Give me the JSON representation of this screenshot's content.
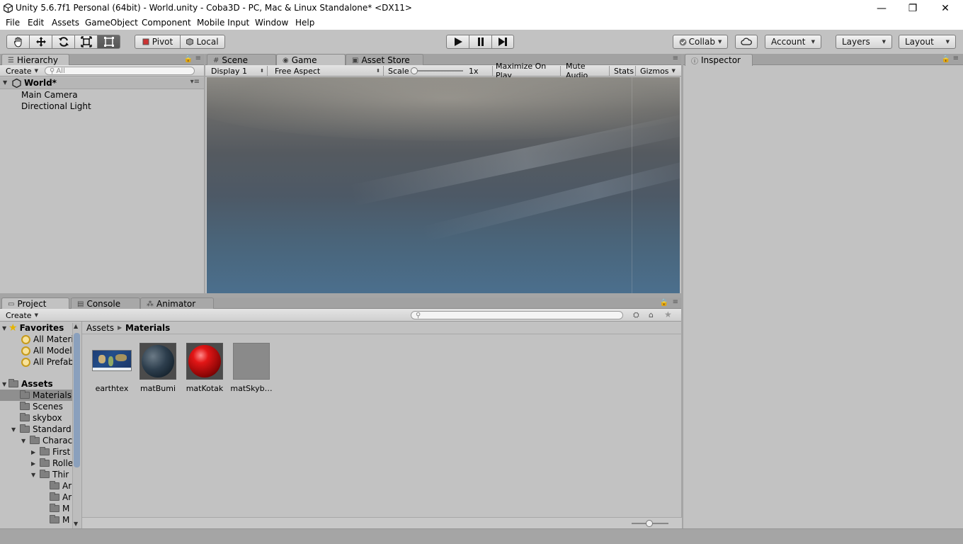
{
  "window": {
    "title": "Unity 5.6.7f1 Personal (64bit) - World.unity - Coba3D - PC, Mac & Linux Standalone* <DX11>",
    "controls": {
      "minimize": "—",
      "restore": "❐",
      "close": "✕"
    }
  },
  "menu": [
    "File",
    "Edit",
    "Assets",
    "GameObject",
    "Component",
    "Mobile Input",
    "Window",
    "Help"
  ],
  "toolbar": {
    "tools": [
      "hand-icon",
      "move-icon",
      "rotate-icon",
      "scale-icon",
      "rect-icon"
    ],
    "pivot": "Pivot",
    "local": "Local",
    "collab": "Collab",
    "account": "Account",
    "layers": "Layers",
    "layout": "Layout"
  },
  "hierarchy": {
    "tab": "Hierarchy",
    "create": "Create",
    "search_placeholder": "All",
    "scene": "World*",
    "items": [
      "Main Camera",
      "Directional Light"
    ]
  },
  "center_tabs": [
    "Scene",
    "Game",
    "Asset Store"
  ],
  "game_bar": {
    "display": "Display 1",
    "aspect": "Free Aspect",
    "scale_label": "Scale",
    "scale_value": "1x",
    "maximize": "Maximize On Play",
    "mute": "Mute Audio",
    "stats": "Stats",
    "gizmos": "Gizmos"
  },
  "inspector": {
    "tab": "Inspector"
  },
  "bottom_tabs": [
    "Project",
    "Console",
    "Animator"
  ],
  "project": {
    "create": "Create",
    "breadcrumb": [
      "Assets",
      "Materials"
    ],
    "favorites_label": "Favorites",
    "favorites": [
      "All Materi",
      "All Model",
      "All Prefab"
    ],
    "assets_label": "Assets",
    "folders": [
      {
        "label": "Materials",
        "depth": 1,
        "arrow": ""
      },
      {
        "label": "Scenes",
        "depth": 1,
        "arrow": ""
      },
      {
        "label": "skybox",
        "depth": 1,
        "arrow": ""
      },
      {
        "label": "Standard",
        "depth": 1,
        "arrow": "▼"
      },
      {
        "label": "Charac",
        "depth": 2,
        "arrow": "▼"
      },
      {
        "label": "First",
        "depth": 3,
        "arrow": "▶"
      },
      {
        "label": "Rolle",
        "depth": 3,
        "arrow": "▶"
      },
      {
        "label": "Thir",
        "depth": 3,
        "arrow": "▼"
      },
      {
        "label": "Ar",
        "depth": 4,
        "arrow": ""
      },
      {
        "label": "Ar",
        "depth": 4,
        "arrow": ""
      },
      {
        "label": "M",
        "depth": 4,
        "arrow": ""
      },
      {
        "label": "M",
        "depth": 4,
        "arrow": ""
      }
    ],
    "items": [
      {
        "label": "earthtex",
        "kind": "texture"
      },
      {
        "label": "matBumi",
        "kind": "earth-sphere"
      },
      {
        "label": "matKotak",
        "kind": "red-sphere"
      },
      {
        "label": "matSkyb…",
        "kind": "grey-square"
      }
    ]
  },
  "colors": {
    "panel_bg": "#c2c2c2",
    "selected_row": "#8f8f8f",
    "accent_red": "#d01010"
  }
}
